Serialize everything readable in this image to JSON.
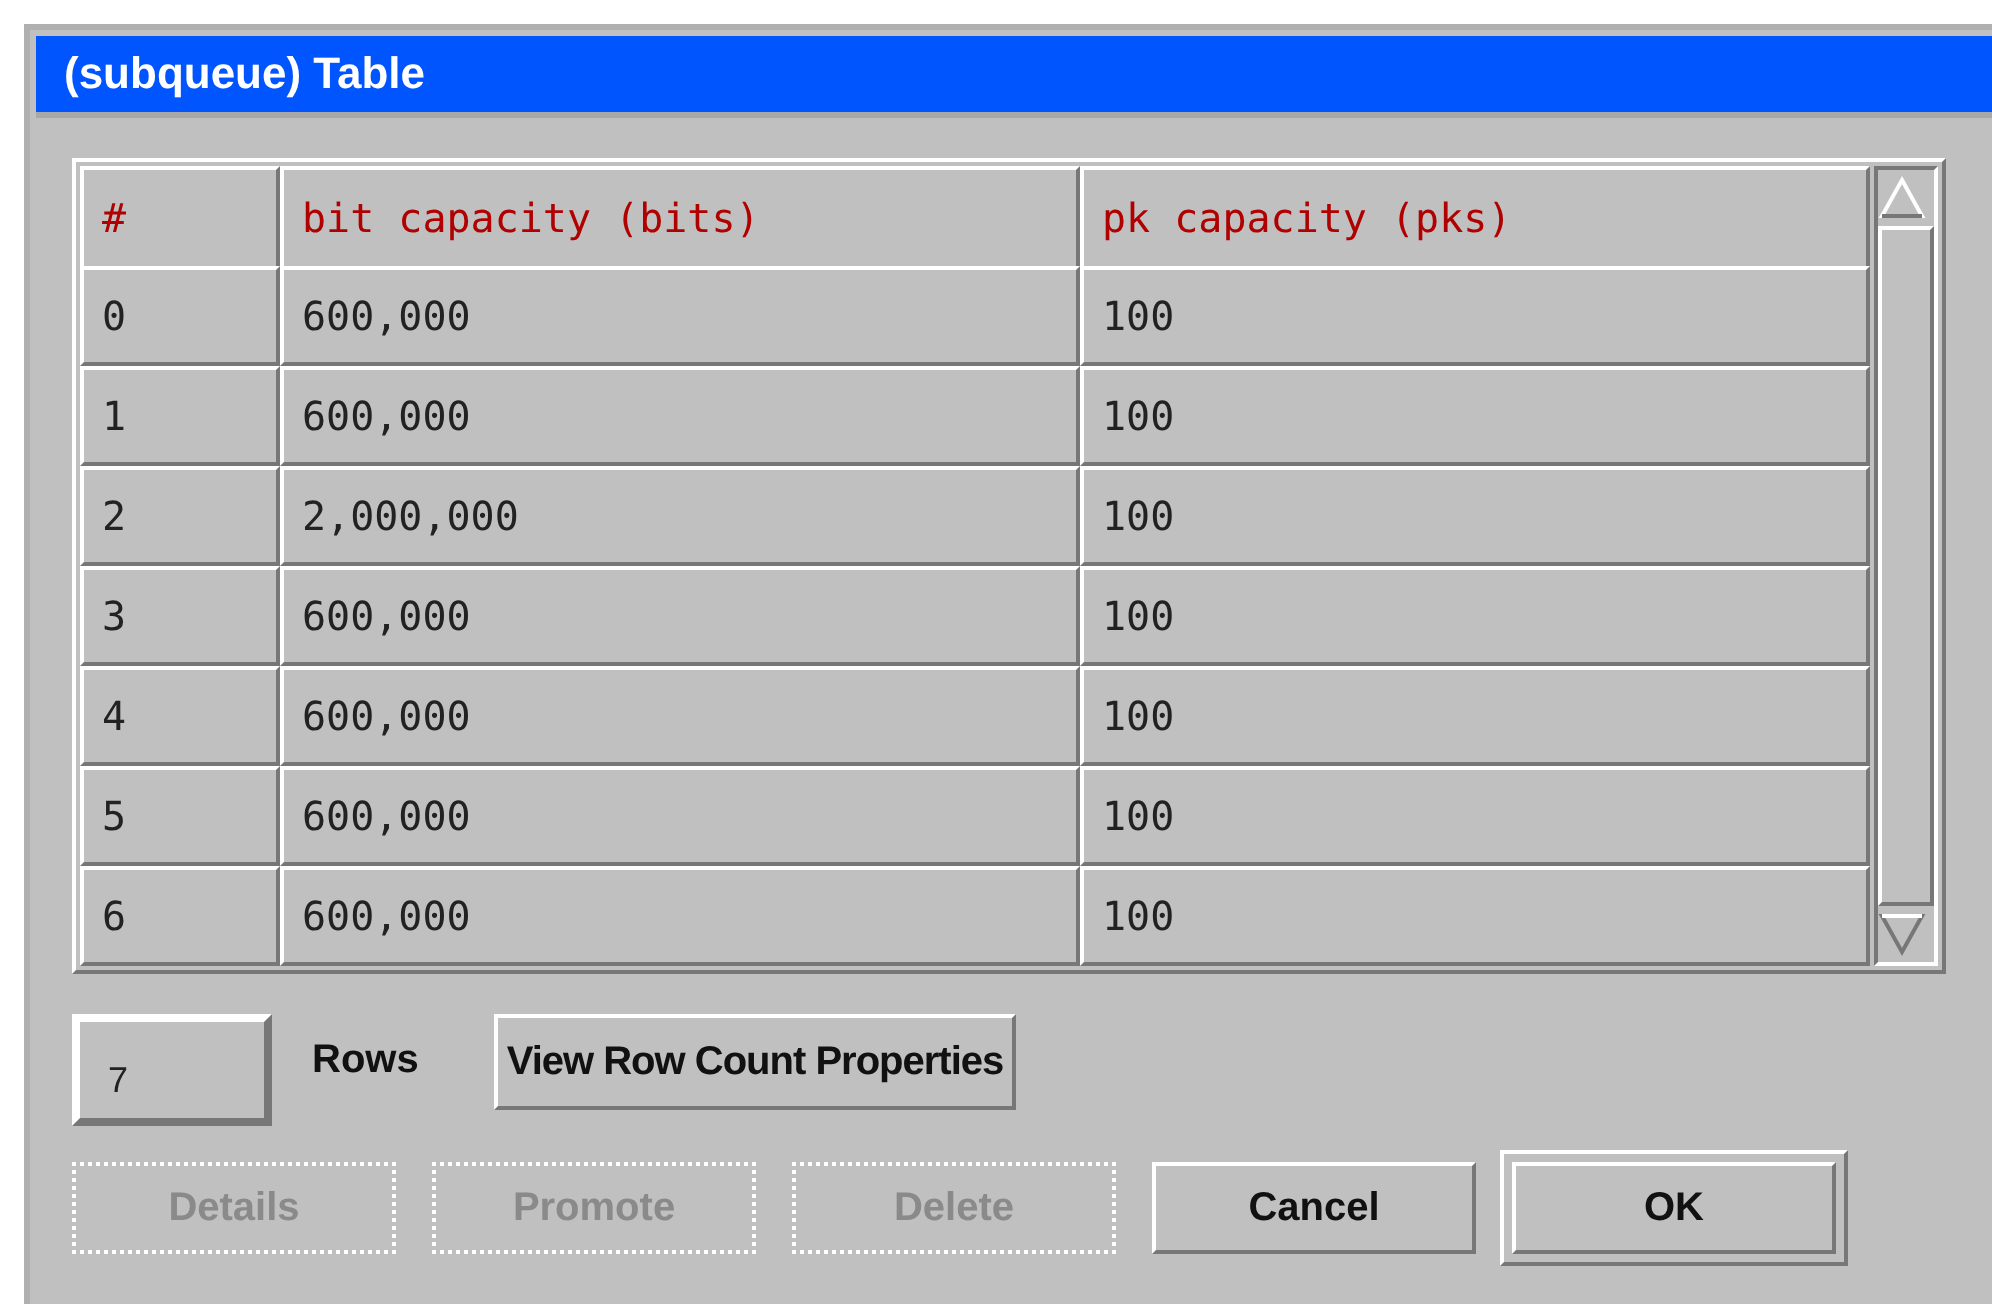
{
  "window": {
    "title": "(subqueue) Table"
  },
  "table": {
    "columns": [
      "#",
      "bit capacity (bits)",
      "pk capacity (pks)"
    ],
    "rows": [
      [
        "0",
        "600,000",
        "100"
      ],
      [
        "1",
        "600,000",
        "100"
      ],
      [
        "2",
        "2,000,000",
        "100"
      ],
      [
        "3",
        "600,000",
        "100"
      ],
      [
        "4",
        "600,000",
        "100"
      ],
      [
        "5",
        "600,000",
        "100"
      ],
      [
        "6",
        "600,000",
        "100"
      ]
    ]
  },
  "row_count": {
    "value": "7",
    "label": "Rows",
    "button": "View Row Count Properties"
  },
  "buttons": [
    {
      "label": "Details",
      "disabled": true,
      "default": false
    },
    {
      "label": "Promote",
      "disabled": true,
      "default": false
    },
    {
      "label": "Delete",
      "disabled": true,
      "default": false
    },
    {
      "label": "Cancel",
      "disabled": false,
      "default": false
    },
    {
      "label": "OK",
      "disabled": false,
      "default": true
    }
  ]
}
